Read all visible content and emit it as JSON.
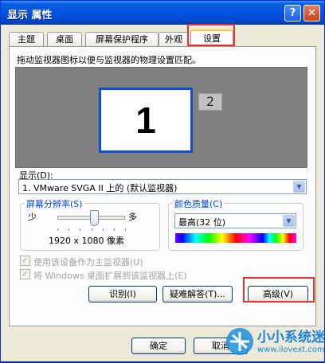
{
  "window": {
    "title": "显示 属性",
    "help_glyph": "?",
    "close_glyph": "✕"
  },
  "tabs": [
    {
      "label": "主题"
    },
    {
      "label": "桌面"
    },
    {
      "label": "屏幕保护程序"
    },
    {
      "label": "外观"
    },
    {
      "label": "设置",
      "active": true
    }
  ],
  "settings": {
    "instruction": "拖动监视器图标以便与监视器的物理设置匹配。",
    "monitors": [
      {
        "label": "1"
      },
      {
        "label": "2"
      }
    ],
    "display_label": "显示(D):",
    "display_value": "1. VMware SVGA II 上的 (默认监视器)",
    "resolution": {
      "group_label": "屏幕分辨率(S)",
      "less": "少",
      "more": "多",
      "value": "1920 x 1080 像素",
      "slider_fraction": 0.55
    },
    "color": {
      "group_label": "颜色质量(C)",
      "value": "最高(32 位)"
    },
    "checkboxes": [
      {
        "label": "使用该设备作为主监视器(U)",
        "checked": true,
        "disabled": true
      },
      {
        "label": "将 Windows 桌面扩展到该监视器上(E)",
        "checked": true,
        "disabled": true
      }
    ],
    "buttons": {
      "identify": "识别(I)",
      "troubleshoot": "疑难解答(T)...",
      "advanced": "高级(V)"
    }
  },
  "footer": {
    "ok": "确定",
    "cancel": "取消"
  },
  "watermark": {
    "brand": "小小系统迷",
    "url": "www.ilovext.com"
  },
  "colors": {
    "title_bar": "#0054e3",
    "highlight": "#e53030",
    "monitor_border": "#0a4fd6"
  }
}
